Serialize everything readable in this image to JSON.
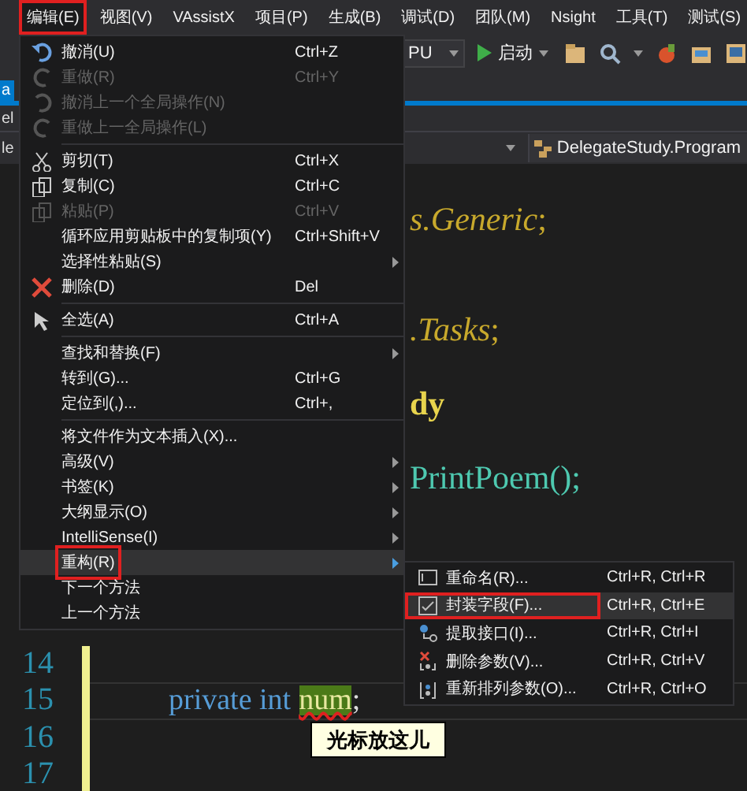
{
  "menubar": [
    {
      "label": "编辑(E)",
      "selected": true,
      "annotated": true
    },
    {
      "label": "视图(V)",
      "selected": false,
      "annotated": false
    },
    {
      "label": "VAssistX",
      "selected": false,
      "annotated": false
    },
    {
      "label": "项目(P)",
      "selected": false,
      "annotated": false
    },
    {
      "label": "生成(B)",
      "selected": false,
      "annotated": false
    },
    {
      "label": "调试(D)",
      "selected": false,
      "annotated": false
    },
    {
      "label": "团队(M)",
      "selected": false,
      "annotated": false
    },
    {
      "label": "Nsight",
      "selected": false,
      "annotated": false
    },
    {
      "label": "工具(T)",
      "selected": false,
      "annotated": false
    },
    {
      "label": "测试(S)",
      "selected": false,
      "annotated": false
    }
  ],
  "toolbar": {
    "platform_combo": "PU",
    "start_button": "启动"
  },
  "tabs": {
    "tab": "a",
    "file_fragment": "el"
  },
  "navbar": {
    "left_fragment": "le",
    "class_combo": "DelegateStudy.Program"
  },
  "editor": {
    "fragments": [
      {
        "kind": "type",
        "text": "*s.Generic*;"
      },
      {
        "kind": "type",
        "text": "*.Tasks*;"
      },
      {
        "kind": "namespace",
        "text": "dy"
      },
      {
        "kind": "method",
        "text": "PrintPoem();"
      }
    ],
    "lines": [
      {
        "number": "14",
        "current": false
      },
      {
        "number": "15",
        "current": true,
        "segments": [
          {
            "kind": "keyword",
            "text": "private int"
          },
          {
            "kind": "identifier",
            "text": "num",
            "error": true
          },
          {
            "kind": "punctuation",
            "text": ";"
          }
        ]
      },
      {
        "number": "16",
        "current": false
      },
      {
        "number": "17",
        "current": false
      }
    ]
  },
  "edit_menu": [
    {
      "kind": "item",
      "label": "撤消(U)",
      "shortcut": "Ctrl+Z",
      "disabled": false
    },
    {
      "kind": "item",
      "label": "重做(R)",
      "shortcut": "Ctrl+Y",
      "disabled": true
    },
    {
      "kind": "item",
      "label": "撤消上一个全局操作(N)",
      "disabled": true
    },
    {
      "kind": "item",
      "label": "重做上一全局操作(L)",
      "disabled": true
    },
    {
      "kind": "separator"
    },
    {
      "kind": "item",
      "label": "剪切(T)",
      "shortcut": "Ctrl+X",
      "disabled": false
    },
    {
      "kind": "item",
      "label": "复制(C)",
      "shortcut": "Ctrl+C",
      "disabled": false
    },
    {
      "kind": "item",
      "label": "粘贴(P)",
      "shortcut": "Ctrl+V",
      "disabled": true
    },
    {
      "kind": "item",
      "label": "循环应用剪贴板中的复制项(Y)",
      "shortcut": "Ctrl+Shift+V",
      "disabled": false
    },
    {
      "kind": "item",
      "label": "选择性粘贴(S)",
      "submenu": true,
      "disabled": false
    },
    {
      "kind": "item",
      "label": "删除(D)",
      "shortcut": "Del",
      "disabled": false
    },
    {
      "kind": "separator"
    },
    {
      "kind": "item",
      "label": "全选(A)",
      "shortcut": "Ctrl+A",
      "disabled": false
    },
    {
      "kind": "separator"
    },
    {
      "kind": "item",
      "label": "查找和替换(F)",
      "submenu": true,
      "disabled": false
    },
    {
      "kind": "item",
      "label": "转到(G)...",
      "shortcut": "Ctrl+G",
      "disabled": false
    },
    {
      "kind": "item",
      "label": "定位到(,)...",
      "shortcut": "Ctrl+,",
      "disabled": false
    },
    {
      "kind": "separator"
    },
    {
      "kind": "item",
      "label": "将文件作为文本插入(X)...",
      "disabled": false
    },
    {
      "kind": "item",
      "label": "高级(V)",
      "submenu": true,
      "disabled": false
    },
    {
      "kind": "item",
      "label": "书签(K)",
      "submenu": true,
      "disabled": false
    },
    {
      "kind": "item",
      "label": "大纲显示(O)",
      "submenu": true,
      "disabled": false
    },
    {
      "kind": "item",
      "label": "IntelliSense(I)",
      "submenu": true,
      "disabled": false
    },
    {
      "kind": "item",
      "label": "重构(R)",
      "submenu": true,
      "disabled": false,
      "selected": true,
      "annotated": true
    },
    {
      "kind": "item",
      "label": "下一个方法",
      "disabled": false
    },
    {
      "kind": "item",
      "label": "上一个方法",
      "disabled": false
    }
  ],
  "refactor_menu": [
    {
      "label": "重命名(R)...",
      "shortcut": "Ctrl+R, Ctrl+R",
      "selected": false,
      "annotated": false
    },
    {
      "label": "封装字段(F)...",
      "shortcut": "Ctrl+R, Ctrl+E",
      "selected": true,
      "annotated": true
    },
    {
      "label": "提取接口(I)...",
      "shortcut": "Ctrl+R, Ctrl+I",
      "selected": false,
      "annotated": false
    },
    {
      "label": "删除参数(V)...",
      "shortcut": "Ctrl+R, Ctrl+V",
      "selected": false,
      "annotated": false
    },
    {
      "label": "重新排列参数(O)...",
      "shortcut": "Ctrl+R, Ctrl+O",
      "selected": false,
      "annotated": false
    }
  ],
  "callout": {
    "text": "光标放这儿"
  }
}
